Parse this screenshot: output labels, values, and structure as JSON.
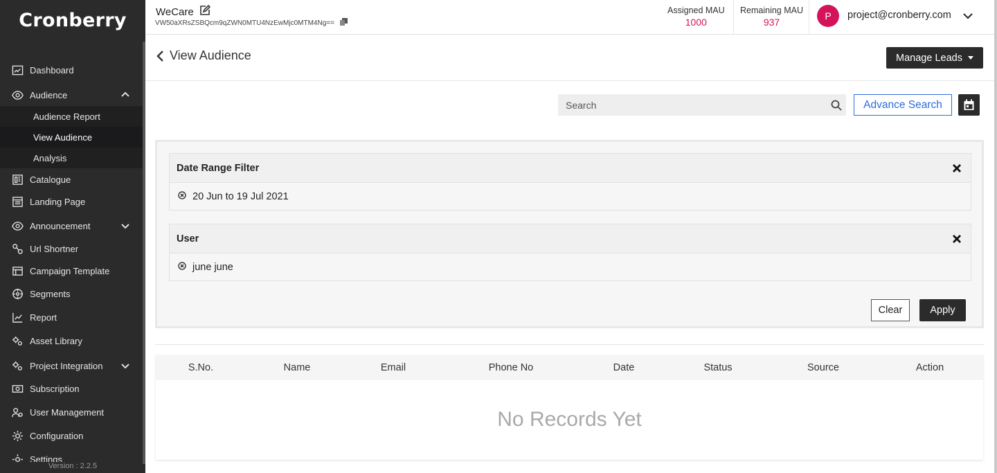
{
  "brand": {
    "logo_text": "Cronberry",
    "version": "Version : 2.2.5"
  },
  "sidebar": {
    "items": [
      {
        "label": "Dashboard",
        "icon": "dashboard-icon"
      },
      {
        "label": "Audience",
        "icon": "eye-icon",
        "expanded": true,
        "children": [
          {
            "label": "Audience Report"
          },
          {
            "label": "View Audience",
            "active": true
          },
          {
            "label": "Analysis"
          }
        ]
      },
      {
        "label": "Catalogue",
        "icon": "catalogue-icon"
      },
      {
        "label": "Landing Page",
        "icon": "landing-page-icon"
      },
      {
        "label": "Announcement",
        "icon": "eye-icon",
        "collapsible": true
      },
      {
        "label": "Url Shortner",
        "icon": "link-icon"
      },
      {
        "label": "Campaign Template",
        "icon": "template-icon"
      },
      {
        "label": "Segments",
        "icon": "segments-icon"
      },
      {
        "label": "Report",
        "icon": "report-chart-icon"
      },
      {
        "label": "Asset Library",
        "icon": "gears-icon"
      },
      {
        "label": "Project Integration",
        "icon": "gears-icon",
        "collapsible": true
      },
      {
        "label": "Subscription",
        "icon": "money-icon"
      },
      {
        "label": "User Management",
        "icon": "users-gear-icon"
      },
      {
        "label": "Configuration",
        "icon": "gear-icon"
      },
      {
        "label": "Settings",
        "icon": "gear-icon"
      }
    ]
  },
  "header": {
    "project_name": "WeCare",
    "project_key": "VW50aXRsZSBQcm9qZWN0MTU4NzEwMjc0MTM4Ng==",
    "assigned_mau_label": "Assigned MAU",
    "assigned_mau_value": "1000",
    "remaining_mau_label": "Remaining MAU",
    "remaining_mau_value": "937",
    "avatar_letter": "P",
    "user_email": "project@cronberry.com"
  },
  "page": {
    "title": "View Audience",
    "manage_leads_label": "Manage Leads"
  },
  "search": {
    "placeholder": "Search",
    "value": "",
    "advance_label": "Advance Search"
  },
  "filters": [
    {
      "title": "Date Range Filter",
      "value": "20 Jun to 19 Jul 2021"
    },
    {
      "title": "User",
      "value": "june june"
    }
  ],
  "filter_actions": {
    "clear_label": "Clear",
    "apply_label": "Apply"
  },
  "table": {
    "columns": [
      "S.No.",
      "Name",
      "Email",
      "Phone No",
      "Date",
      "Status",
      "Source",
      "Action"
    ],
    "rows": [],
    "empty_text": "No Records Yet"
  },
  "colors": {
    "accent": "#d4145a",
    "link": "#2d6cdf",
    "sidebar_bg": "#2b2b2b",
    "dark_button": "#2b2b2b"
  }
}
